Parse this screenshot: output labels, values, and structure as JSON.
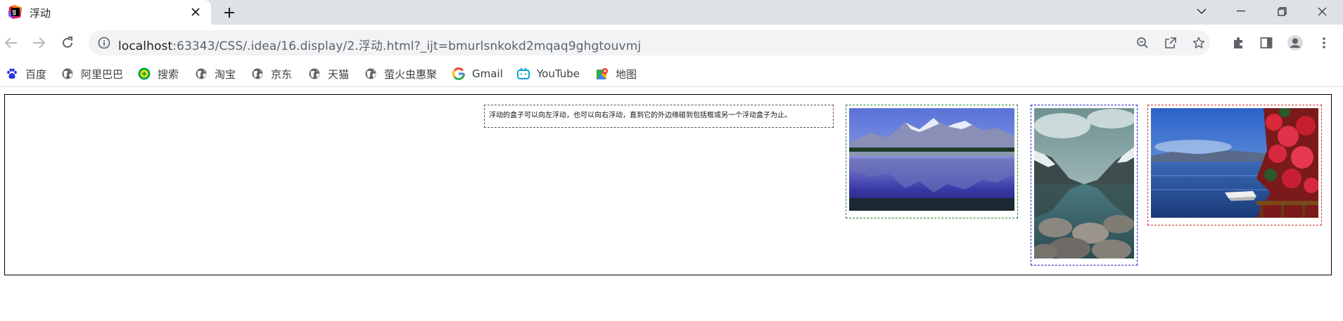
{
  "tab": {
    "title": "浮动",
    "close_icon": "close-icon",
    "favicon": "jetbrains-icon"
  },
  "new_tab_icon": "plus-icon",
  "window_controls": [
    "chevron-down-icon",
    "minimize-icon",
    "restore-icon",
    "close-icon"
  ],
  "toolbar": {
    "url_host": "localhost",
    "url_rest": ":63343/CSS/.idea/16.display/2.浮动.html?_ijt=bmurlsnkokd2mqaq9ghgtouvmj"
  },
  "bookmarks": [
    {
      "label": "百度",
      "icon": "baidu-paw-icon"
    },
    {
      "label": "阿里巴巴",
      "icon": "globe-icon"
    },
    {
      "label": "搜索",
      "icon": "search-ball-icon"
    },
    {
      "label": "淘宝",
      "icon": "globe-icon"
    },
    {
      "label": "京东",
      "icon": "globe-icon"
    },
    {
      "label": "天猫",
      "icon": "globe-icon"
    },
    {
      "label": "萤火虫惠聚",
      "icon": "globe-icon"
    },
    {
      "label": "Gmail",
      "icon": "google-icon"
    },
    {
      "label": "YouTube",
      "icon": "bilibili-tv-icon"
    },
    {
      "label": "地图",
      "icon": "maps-pin-icon"
    }
  ],
  "page": {
    "float_text": "浮动的盒子可以向左浮动，也可以向右浮动，直到它的外边缘碰到包括框或另一个浮动盒子为止。",
    "images": [
      {
        "name": "mountain-lake-photo",
        "border_color": "#2e7d32"
      },
      {
        "name": "glacier-lake-photo",
        "border_color": "#1e22c8"
      },
      {
        "name": "flower-lake-photo",
        "border_color": "#d32f2f"
      }
    ]
  },
  "colors": {
    "tabstrip_bg": "#dee1e6",
    "omnibox_bg": "#f1f3f4",
    "text_primary": "#202124",
    "text_secondary": "#5f6368"
  }
}
